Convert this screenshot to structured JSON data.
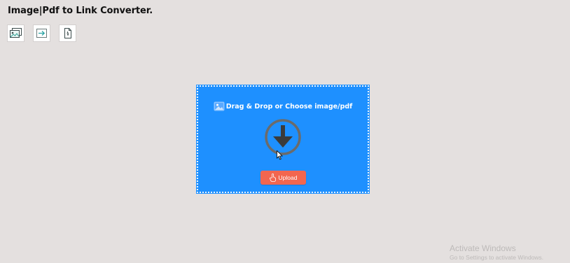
{
  "app": {
    "title": "Image|Pdf to Link Converter."
  },
  "toolbar": {
    "items": [
      {
        "icon": "image-gallery-icon"
      },
      {
        "icon": "arrow-right-icon"
      },
      {
        "icon": "pdf-document-icon"
      }
    ]
  },
  "drop_zone": {
    "label": "Drag & Drop or Choose image/pdf",
    "background_color": "#1e90ff",
    "icon": "image-icon",
    "drop_icon": "download-arrow-icon"
  },
  "upload_button": {
    "label": "Upload",
    "icon": "hand-pointer-icon",
    "color": "#f2664f"
  },
  "watermark": {
    "title": "Activate Windows",
    "subtitle": "Go to Settings to activate Windows."
  }
}
